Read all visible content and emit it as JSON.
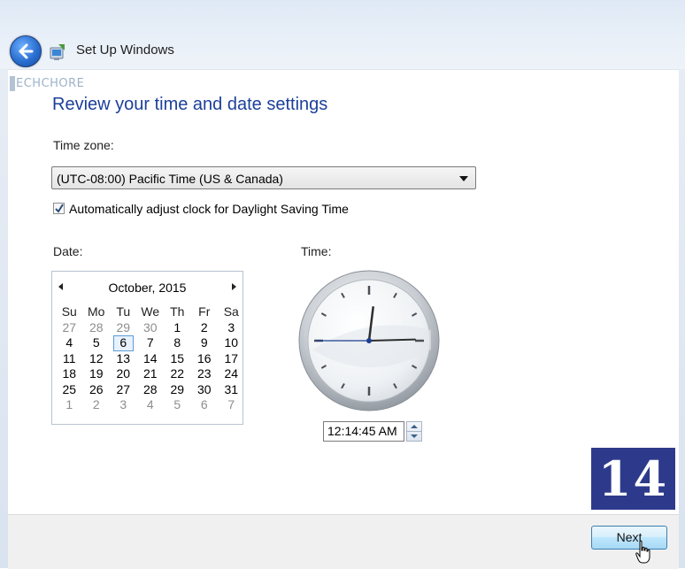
{
  "window": {
    "title": "Set Up Windows"
  },
  "watermark": {
    "text": "ECHCHORE"
  },
  "page": {
    "heading": "Review your time and date settings"
  },
  "timezone": {
    "label": "Time zone:",
    "selected": "(UTC-08:00) Pacific Time (US & Canada)"
  },
  "dst": {
    "label": "Automatically adjust clock for Daylight Saving Time",
    "checked": true
  },
  "date": {
    "label": "Date:",
    "month_title": "October, 2015",
    "weekdays": [
      "Su",
      "Mo",
      "Tu",
      "We",
      "Th",
      "Fr",
      "Sa"
    ],
    "days": [
      [
        "27",
        "28",
        "29",
        "30",
        "1",
        "2",
        "3"
      ],
      [
        "4",
        "5",
        "6",
        "7",
        "8",
        "9",
        "10"
      ],
      [
        "11",
        "12",
        "13",
        "14",
        "15",
        "16",
        "17"
      ],
      [
        "18",
        "19",
        "20",
        "21",
        "22",
        "23",
        "24"
      ],
      [
        "25",
        "26",
        "27",
        "28",
        "29",
        "30",
        "31"
      ],
      [
        "1",
        "2",
        "3",
        "4",
        "5",
        "6",
        "7"
      ]
    ],
    "selected_day": "6"
  },
  "time": {
    "label": "Time:",
    "value": "12:14:45 AM"
  },
  "step_badge": {
    "text": "14"
  },
  "footer": {
    "next_label": "Next"
  },
  "colors": {
    "heading": "#1c3f9a",
    "badge_bg": "#2d3a8c",
    "selected_day_border": "#5b9bd5"
  }
}
